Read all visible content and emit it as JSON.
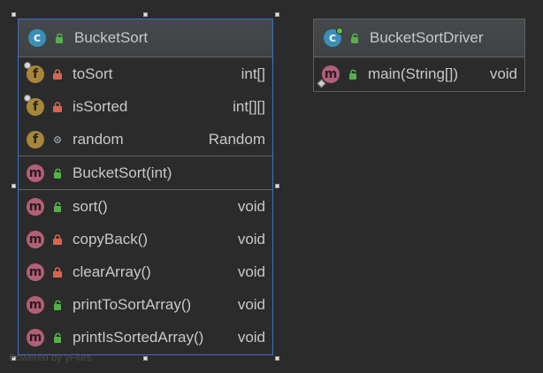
{
  "diagram": {
    "watermark": "Powered by yFiles",
    "bucket_sort": {
      "class_icon": "class-icon",
      "visibility_icon": "public-unlocked-icon",
      "title": "BucketSort",
      "fields": [
        {
          "name": "toSort",
          "type": "int[]",
          "icon": "field-icon",
          "visibility": "private-lock-icon",
          "pinned": true
        },
        {
          "name": "isSorted",
          "type": "int[][]",
          "icon": "field-icon",
          "visibility": "private-lock-icon",
          "pinned": true
        },
        {
          "name": "random",
          "type": "Random",
          "icon": "field-icon",
          "visibility": "package-dot-icon",
          "pinned": false
        }
      ],
      "constructors": [
        {
          "name": "BucketSort(int)",
          "type": "",
          "icon": "method-icon",
          "visibility": "public-unlocked-icon"
        }
      ],
      "methods": [
        {
          "name": "sort()",
          "type": "void",
          "icon": "method-icon",
          "visibility": "public-unlocked-icon"
        },
        {
          "name": "copyBack()",
          "type": "void",
          "icon": "method-icon",
          "visibility": "private-lock-icon"
        },
        {
          "name": "clearArray()",
          "type": "void",
          "icon": "method-icon",
          "visibility": "private-lock-icon"
        },
        {
          "name": "printToSortArray()",
          "type": "void",
          "icon": "method-icon",
          "visibility": "public-unlocked-icon"
        },
        {
          "name": "printIsSortedArray()",
          "type": "void",
          "icon": "method-icon",
          "visibility": "public-unlocked-icon"
        }
      ]
    },
    "bucket_sort_driver": {
      "class_icon": "class-icon",
      "visibility_icon": "public-unlocked-icon",
      "title": "BucketSortDriver",
      "methods": [
        {
          "name": "main(String[])",
          "type": "void",
          "icon": "method-icon",
          "visibility": "public-unlocked-icon",
          "static": true
        }
      ]
    }
  }
}
